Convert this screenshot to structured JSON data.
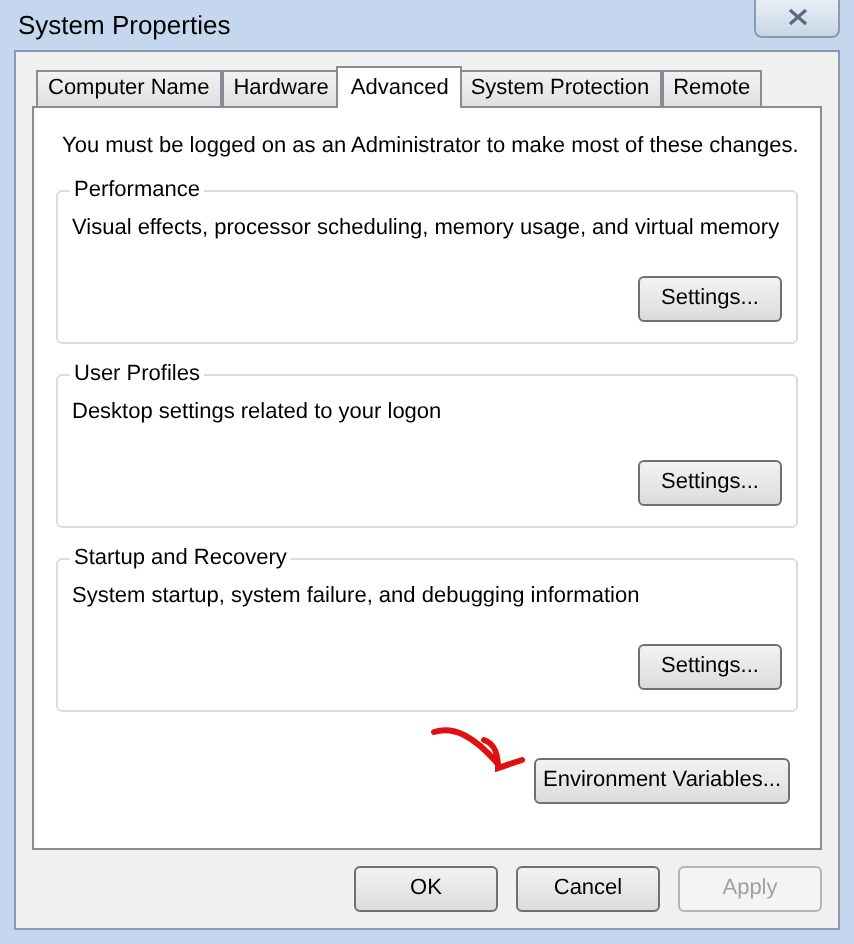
{
  "window": {
    "title": "System Properties"
  },
  "tabs": [
    {
      "label": "Computer Name",
      "selected": false
    },
    {
      "label": "Hardware",
      "selected": false
    },
    {
      "label": "Advanced",
      "selected": true
    },
    {
      "label": "System Protection",
      "selected": false
    },
    {
      "label": "Remote",
      "selected": false
    }
  ],
  "notice": "You must be logged on as an Administrator to make most of these changes.",
  "groups": [
    {
      "title": "Performance",
      "description": "Visual effects, processor scheduling, memory usage, and virtual memory",
      "button": "Settings..."
    },
    {
      "title": "User Profiles",
      "description": "Desktop settings related to your logon",
      "button": "Settings..."
    },
    {
      "title": "Startup and Recovery",
      "description": "System startup, system failure, and debugging information",
      "button": "Settings..."
    }
  ],
  "environment_button": "Environment Variables...",
  "buttons": [
    {
      "label": "OK",
      "disabled": false
    },
    {
      "label": "Cancel",
      "disabled": false
    },
    {
      "label": "Apply",
      "disabled": true
    }
  ]
}
